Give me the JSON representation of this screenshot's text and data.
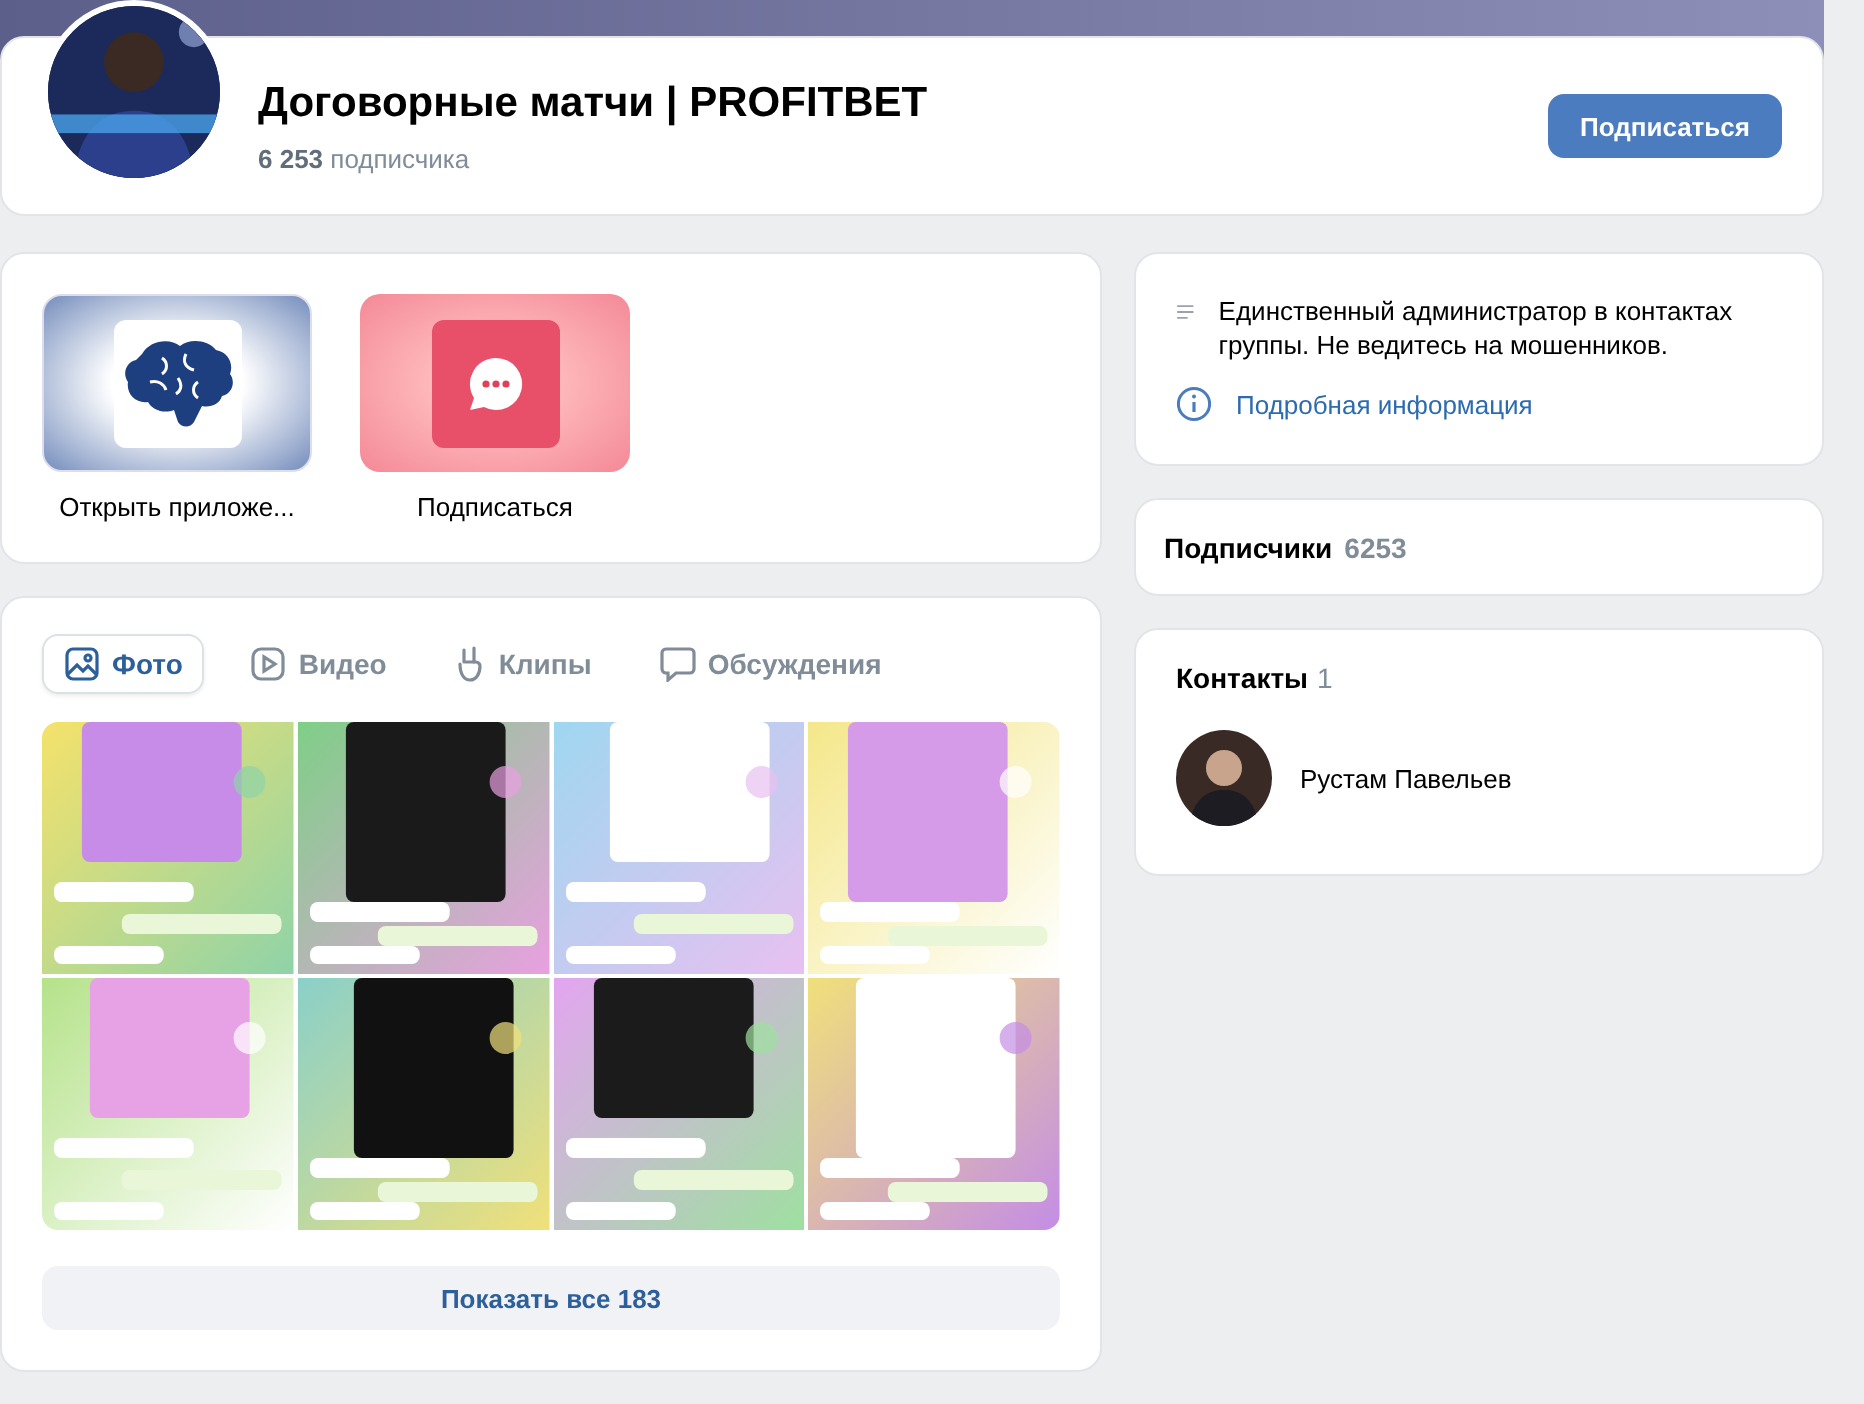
{
  "header": {
    "title": "Договорные матчи | PROFITBET",
    "subscriber_count": "6 253",
    "subscriber_label": "подписчика",
    "button": "Подписаться"
  },
  "apps": [
    {
      "kind": "brain",
      "label": "Открыть приложе..."
    },
    {
      "kind": "chat",
      "label": "Подписаться"
    }
  ],
  "media": {
    "tabs": [
      {
        "label": "Фото",
        "selected": true
      },
      {
        "kind": "video",
        "label": "Видео",
        "selected": false
      },
      {
        "kind": "clips",
        "label": "Клипы",
        "selected": false
      },
      {
        "kind": "discussions",
        "label": "Обсуждения",
        "selected": false
      }
    ],
    "show_all": "Показать все 183"
  },
  "info": {
    "description": "Единственный администратор в контактах группы. Не ведитесь на мошенников.",
    "more": "Подробная информация"
  },
  "subscribers": {
    "title": "Подписчики",
    "count": "6253"
  },
  "contacts": {
    "title": "Контакты",
    "count": "1",
    "people": [
      {
        "name": "Рустам Павельев"
      }
    ]
  }
}
